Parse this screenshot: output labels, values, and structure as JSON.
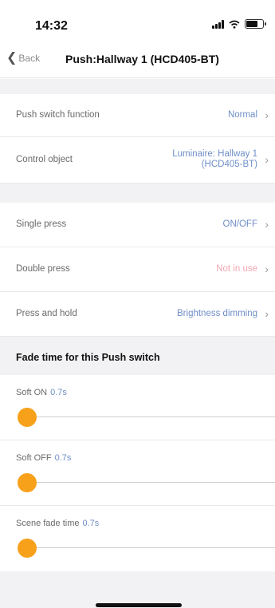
{
  "status_bar": {
    "time": "14:32"
  },
  "nav": {
    "back_label": "Back",
    "title": "Push:Hallway 1 (HCD405-BT)"
  },
  "settings": [
    {
      "label": "Push switch function",
      "value": "Normal"
    },
    {
      "label": "Control object",
      "value_line1": "Luminaire: Hallway 1",
      "value_line2": "(HCD405-BT)"
    }
  ],
  "press_actions": [
    {
      "label": "Single press",
      "value": "ON/OFF"
    },
    {
      "label": "Double press",
      "value": "Not in use"
    },
    {
      "label": "Press and hold",
      "value": "Brightness dimming"
    }
  ],
  "fade_section": {
    "title": "Fade time for this Push switch",
    "sliders": [
      {
        "label": "Soft ON",
        "value": "0.7s",
        "level": 0
      },
      {
        "label": "Soft OFF",
        "value": "0.7s",
        "level": 0
      },
      {
        "label": "Scene fade time",
        "value": "0.7s",
        "level": 0
      }
    ]
  },
  "colors": {
    "accent_value": "#6f8ec8",
    "slider_thumb": "#f7a11a",
    "inactive_value": "#f2a6b2"
  },
  "icons": {
    "back": "chevron-left-icon",
    "row_arrow": "chevron-right-icon"
  }
}
